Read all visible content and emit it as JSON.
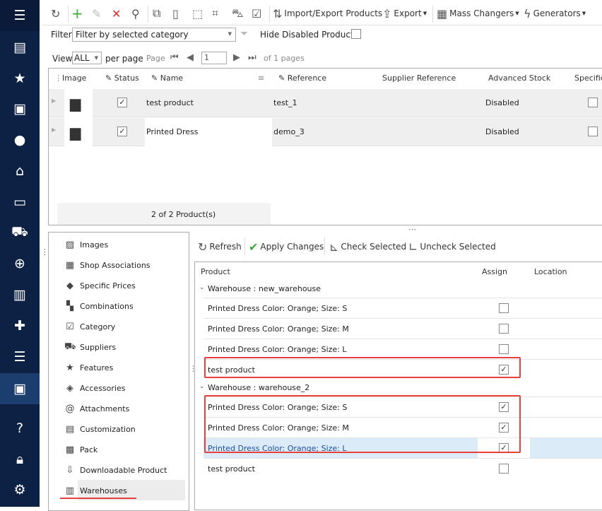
{
  "sidebar": {
    "icons": [
      "menu-icon",
      "store-icon",
      "star-icon",
      "inbox-icon",
      "user-icon",
      "basket-icon",
      "chat-icon",
      "truck-icon",
      "globe-icon",
      "chart-icon",
      "puzzle-icon",
      "sliders-icon",
      "products-icon",
      "help-icon",
      "lock-icon",
      "gear-icon"
    ],
    "active": "products-icon"
  },
  "toolbar": {
    "import_export": "Import/Export Products",
    "export": "Export",
    "mass_changers": "Mass Changers",
    "generators": "Generators"
  },
  "filter": {
    "label": "Filter",
    "value": "Filter by selected category",
    "hide_disabled": "Hide Disabled Products",
    "hide_disabled_checked": false
  },
  "paging": {
    "view_label": "View",
    "view_value": "ALL",
    "per_page": "per page",
    "page_label": "Page",
    "page_value": "1",
    "of_pages": "of 1 pages"
  },
  "products_grid": {
    "columns": [
      "Image",
      "Status",
      "Name",
      "Reference",
      "Supplier Reference",
      "Advanced Stock Mana",
      "Specific"
    ],
    "rows": [
      {
        "status": true,
        "name": "test product",
        "reference": "test_1",
        "adv_stock": "Disabled"
      },
      {
        "status": true,
        "name": "Printed Dress",
        "reference": "demo_3",
        "adv_stock": "Disabled"
      }
    ],
    "footer": "2 of 2 Product(s)"
  },
  "tabs": [
    "Images",
    "Shop Associations",
    "Specific Prices",
    "Combinations",
    "Category",
    "Suppliers",
    "Features",
    "Accessories",
    "Attachments",
    "Customization",
    "Pack",
    "Downloadable Product",
    "Warehouses"
  ],
  "active_tab": "Warehouses",
  "wh_toolbar": {
    "refresh": "Refresh",
    "apply": "Apply Changes",
    "check": "Check Selected",
    "uncheck": "Uncheck Selected"
  },
  "wh_grid": {
    "columns": [
      "Product",
      "Assign",
      "Location"
    ],
    "groups": [
      {
        "label": "Warehouse : new_warehouse",
        "rows": [
          {
            "product": "Printed Dress Color: Orange; Size: S",
            "assign": false
          },
          {
            "product": "Printed Dress Color: Orange; Size: M",
            "assign": false
          },
          {
            "product": "Printed Dress Color: Orange; Size: L",
            "assign": false
          },
          {
            "product": "test product",
            "assign": true
          }
        ]
      },
      {
        "label": "Warehouse : warehouse_2",
        "rows": [
          {
            "product": "Printed Dress Color: Orange; Size: S",
            "assign": true
          },
          {
            "product": "Printed Dress Color: Orange; Size: M",
            "assign": true
          },
          {
            "product": "Printed Dress Color: Orange; Size: L",
            "assign": true,
            "selected": true
          },
          {
            "product": "test product",
            "assign": false
          }
        ]
      }
    ]
  },
  "colors": {
    "sidebar": "#0d2145",
    "highlight": "#e8413d",
    "selected_row": "#dcebf8"
  }
}
